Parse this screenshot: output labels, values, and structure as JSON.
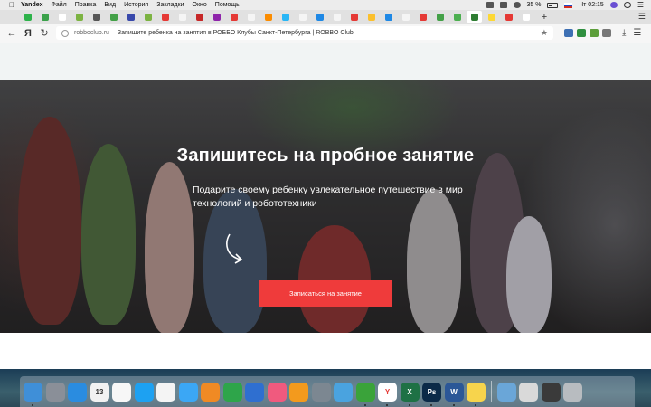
{
  "menubar": {
    "app_name": "Yandex",
    "items": [
      "Файл",
      "Правка",
      "Вид",
      "История",
      "Закладки",
      "Окно",
      "Помощь"
    ],
    "battery": "35 %",
    "clock": "Чт 02:15"
  },
  "tabs": [
    {
      "color": "#2db24a"
    },
    {
      "color": "#3aa14a"
    },
    {
      "color": "#ffffff"
    },
    {
      "color": "#7cb342"
    },
    {
      "color": "#555555"
    },
    {
      "color": "#43a047"
    },
    {
      "color": "#3949ab"
    },
    {
      "color": "#7cb342"
    },
    {
      "color": "#e53935"
    },
    {
      "color": "#f5f5f5"
    },
    {
      "color": "#c62828"
    },
    {
      "color": "#8e24aa"
    },
    {
      "color": "#e53935"
    },
    {
      "color": "#f5f5f5"
    },
    {
      "color": "#fb8c00"
    },
    {
      "color": "#29b6f6"
    },
    {
      "color": "#f5f5f5"
    },
    {
      "color": "#1e88e5"
    },
    {
      "color": "#f5f5f5"
    },
    {
      "color": "#e53935"
    },
    {
      "color": "#fbc02d"
    },
    {
      "color": "#1e88e5"
    },
    {
      "color": "#f5f5f5"
    },
    {
      "color": "#e53935"
    },
    {
      "color": "#43a047"
    },
    {
      "color": "#4caf50"
    },
    {
      "color": "#2e7d32",
      "active": true
    },
    {
      "color": "#fdd835"
    },
    {
      "color": "#e53935"
    },
    {
      "color": "#ffffff"
    }
  ],
  "address": {
    "domain": "robboclub.ru",
    "page_title": "Запишите ребенка на занятия в РОББО Клубы Санкт-Петербурга | ROBBO Club"
  },
  "hero": {
    "title": "Запишитесь на пробное занятие",
    "subtitle": "Подарите своему ребенку увлекательное путешествие в мир технологий и робототехники",
    "cta_label": "Записаться на занятие"
  },
  "dock": {
    "apps": [
      {
        "name": "finder-icon",
        "color": "#3f8fd8",
        "running": true
      },
      {
        "name": "launchpad-icon",
        "color": "#8a8f98"
      },
      {
        "name": "safari-icon",
        "color": "#2a8ce0"
      },
      {
        "name": "calendar-icon",
        "color": "#f2f2f2",
        "label": "13"
      },
      {
        "name": "reminders-icon",
        "color": "#f7f7f7"
      },
      {
        "name": "app-store-icon",
        "color": "#1da1f2"
      },
      {
        "name": "photos-icon",
        "color": "#f4f4f4"
      },
      {
        "name": "messages-icon",
        "color": "#3ba7f5"
      },
      {
        "name": "pages-icon",
        "color": "#f08a24"
      },
      {
        "name": "numbers-icon",
        "color": "#2ea54a"
      },
      {
        "name": "keynote-icon",
        "color": "#2f6fd0"
      },
      {
        "name": "itunes-icon",
        "color": "#f05a7e"
      },
      {
        "name": "ibooks-icon",
        "color": "#f39a1d"
      },
      {
        "name": "system-preferences-icon",
        "color": "#7c8791"
      },
      {
        "name": "testflight-icon",
        "color": "#4aa3df"
      },
      {
        "name": "utorrent-icon",
        "color": "#3aa33a",
        "running": true
      },
      {
        "name": "yandex-browser-icon",
        "color": "#ffffff",
        "running": true,
        "label": "Y"
      },
      {
        "name": "excel-icon",
        "color": "#1e7145",
        "running": true,
        "label": "X"
      },
      {
        "name": "photoshop-icon",
        "color": "#0b2a48",
        "running": true,
        "label": "Ps"
      },
      {
        "name": "word-icon",
        "color": "#2b5797",
        "running": true,
        "label": "W"
      },
      {
        "name": "notes-icon",
        "color": "#f7d44c",
        "running": true
      }
    ],
    "right": [
      {
        "name": "downloads-folder-icon",
        "color": "#6aa6d8"
      },
      {
        "name": "documents-stack-icon",
        "color": "#d9d9d9"
      },
      {
        "name": "screenshots-stack-icon",
        "color": "#3a3a3a"
      },
      {
        "name": "trash-icon",
        "color": "#b8bcc0"
      }
    ]
  }
}
